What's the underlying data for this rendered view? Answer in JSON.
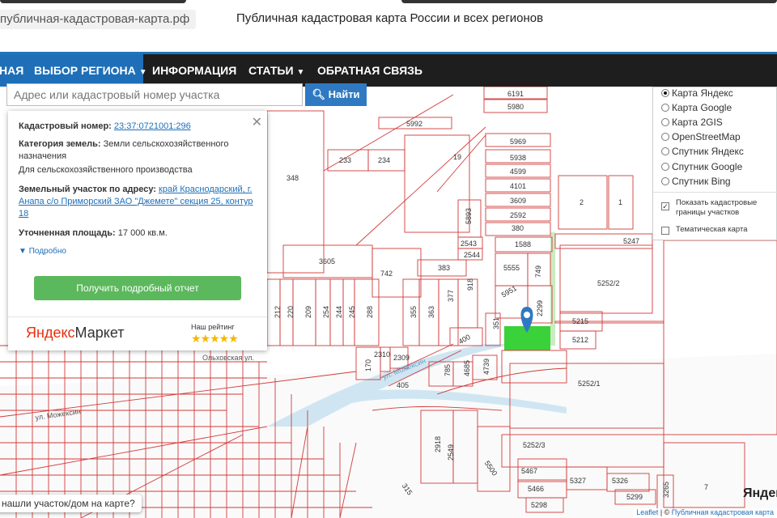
{
  "browser": {
    "url": "публичная-кадастровая-карта.рф"
  },
  "header": {
    "title": "Публичная кадастровая карта России и всех регионов",
    "accent": "#1f75b8"
  },
  "nav": {
    "items": [
      {
        "label": "НАЯ"
      },
      {
        "label": "ВЫБОР РЕГИОНА"
      },
      {
        "label": "ИНФОРМАЦИЯ"
      },
      {
        "label": "СТАТЬИ"
      },
      {
        "label": "ОБРАТНАЯ СВЯЗЬ"
      }
    ]
  },
  "search": {
    "placeholder": "Адрес или кадастровый номер участка",
    "button": "Найти"
  },
  "info": {
    "cad_label": "Кадастровый номер:",
    "cad_value": "23:37:0721001:296",
    "cat_label": "Категория земель:",
    "cat_value": "Земли сельскохозяйственного назначения",
    "cat_use": "Для сельскохозяйственного производства",
    "addr_label": "Земельный участок по адресу:",
    "addr_value": "край Краснодарский, г. Анапа с/о Приморский ЗАО \"Джемете\" секция 25, контур 18",
    "area_label": "Уточненная площадь:",
    "area_value": "17 000 кв.м.",
    "more": "Подробно",
    "report_button": "Получить подробный отчет",
    "market_logo_a": "Яндекс",
    "market_logo_b": "Маркет",
    "rating_label": "Наш рейтинг",
    "stars": "★★★★★"
  },
  "layers": {
    "options": [
      {
        "label": "Карта Яндекс",
        "selected": true
      },
      {
        "label": "Карта Google",
        "selected": false
      },
      {
        "label": "Карта 2GIS",
        "selected": false
      },
      {
        "label": "OpenStreetMap",
        "selected": false
      },
      {
        "label": "Спутник Яндекс",
        "selected": false
      },
      {
        "label": "Спутник Google",
        "selected": false
      },
      {
        "label": "Спутник Bing",
        "selected": false
      }
    ],
    "show_borders": "Показать кадастровые границы участков",
    "thematic": "Тематическая карта"
  },
  "map": {
    "parcel_labels": [
      "6191",
      "5980",
      "5992",
      "5969",
      "5938",
      "4599",
      "4101",
      "3609",
      "2592",
      "380",
      "1588",
      "5247",
      "2",
      "1",
      "348",
      "233",
      "234",
      "19",
      "5893",
      "2543",
      "2544",
      "3605",
      "742",
      "383",
      "5555",
      "749",
      "5252/2",
      "5951",
      "2299",
      "5215",
      "5212",
      "212",
      "220",
      "209",
      "254",
      "244",
      "245",
      "288",
      "355",
      "363",
      "377",
      "918",
      "400",
      "351",
      "170",
      "2310",
      "2309",
      "405",
      "785",
      "4685",
      "4739",
      "5252/1",
      "5252/3",
      "2918",
      "2549",
      "5500",
      "5467",
      "5466",
      "5327",
      "5326",
      "5298",
      "5299",
      "315",
      "7",
      "3265"
    ],
    "street_labels": [
      "ул. Можексин",
      "Ольховская ул.",
      "ул. Можексин"
    ]
  },
  "bottom": {
    "prompt": "нашли участок/дом на карте?"
  },
  "attribution": {
    "leaflet": "Leaflet",
    "sep": " | © ",
    "site": "Публичная кадастровая карта",
    "yandex_wm": "Яндекс"
  }
}
